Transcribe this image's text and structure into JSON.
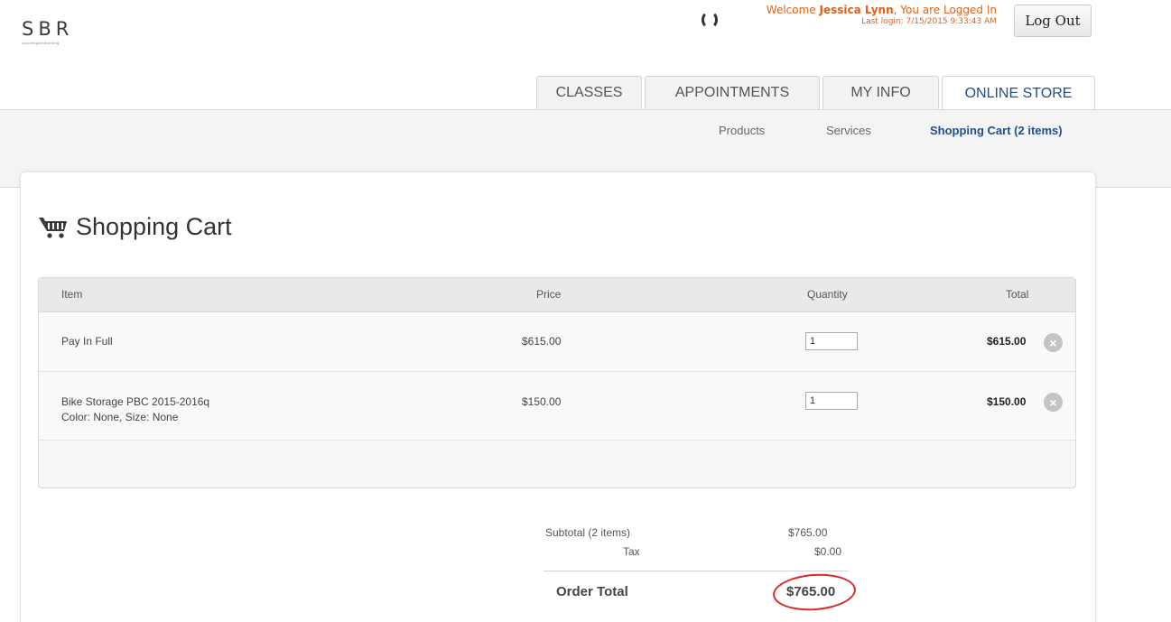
{
  "brand": {
    "logo_text": "SBR",
    "logo_tagline": "coachingandtraining"
  },
  "header": {
    "welcome_prefix": "Welcome ",
    "user_name": "Jessica Lynn",
    "welcome_suffix": ", You are Logged In",
    "last_login": "Last login: 7/15/2015 9:33:43 AM",
    "logout_label": "Log Out"
  },
  "tabs": [
    {
      "label": "CLASSES",
      "active": false
    },
    {
      "label": "APPOINTMENTS",
      "active": false
    },
    {
      "label": "MY INFO",
      "active": false
    },
    {
      "label": "ONLINE STORE",
      "active": true
    }
  ],
  "subnav": {
    "products": "Products",
    "services": "Services",
    "cart": "Shopping Cart (2 items)"
  },
  "page_title": "Shopping Cart",
  "table": {
    "headers": {
      "item": "Item",
      "price": "Price",
      "quantity": "Quantity",
      "total": "Total"
    },
    "rows": [
      {
        "item": "Pay In Full",
        "detail": "",
        "price": "$615.00",
        "quantity": "1",
        "total": "$615.00"
      },
      {
        "item": "Bike Storage PBC 2015-2016q",
        "detail": "Color: None, Size: None",
        "price": "$150.00",
        "quantity": "1",
        "total": "$150.00"
      }
    ]
  },
  "summary": {
    "subtotal_label": "Subtotal  (2 items)",
    "subtotal_value": "$765.00",
    "tax_label": "Tax",
    "tax_value": "$0.00",
    "order_total_label": "Order Total",
    "order_total_value": "$765.00"
  },
  "colors": {
    "accent": "#234e8a",
    "welcome": "#e0601a",
    "annotation_circle": "#d8282b"
  }
}
